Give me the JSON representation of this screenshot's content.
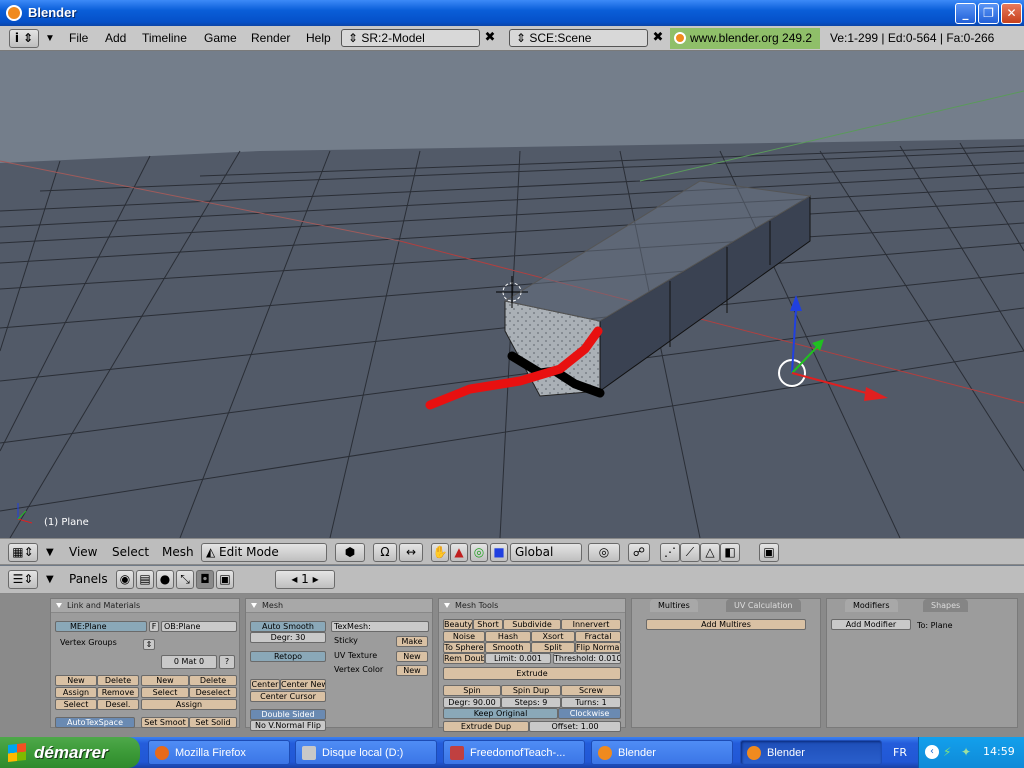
{
  "window": {
    "title": "Blender"
  },
  "menubar": {
    "menus": [
      "File",
      "Add",
      "Timeline",
      "Game",
      "Render",
      "Help"
    ],
    "screen": "SR:2-Model",
    "scene": "SCE:Scene",
    "close_glyph": "✖",
    "website": "www.blender.org 249.2",
    "stats": "Ve:1-299 | Ed:0-564 | Fa:0-266"
  },
  "viewport": {
    "object_info": "(1) Plane"
  },
  "view_header": {
    "view": "View",
    "select": "Select",
    "mesh": "Mesh",
    "mode": "Edit Mode",
    "orientation": "Global"
  },
  "buttons_header": {
    "panels": "Panels",
    "frame": "1"
  },
  "panels": {
    "link_materials": {
      "title": "Link and Materials",
      "me": "ME:Plane",
      "f": "F",
      "ob": "OB:Plane",
      "vertex_groups": "Vertex Groups",
      "mat": "0 Mat 0",
      "q": "?",
      "new1": "New",
      "delete1": "Delete",
      "new2": "New",
      "delete2": "Delete",
      "assign1": "Assign",
      "remove": "Remove",
      "select1": "Select",
      "deselect1": "Deselect",
      "select2": "Select",
      "desel": "Desel.",
      "assign2": "Assign",
      "autotex": "AutoTexSpace",
      "setsmooth": "Set Smoot",
      "setsolid": "Set Solid"
    },
    "mesh": {
      "title": "Mesh",
      "auto_smooth": "Auto Smooth",
      "degr": "Degr: 30",
      "texmesh": "TexMesh:",
      "sticky": "Sticky",
      "make": "Make",
      "retopo": "Retopo",
      "uv_texture": "UV Texture",
      "new1": "New",
      "vertex_color": "Vertex Color",
      "new2": "New",
      "center": "Center",
      "center_new": "Center New",
      "center_cursor": "Center Cursor",
      "double_sided": "Double Sided",
      "no_vnormal": "No V.Normal Flip"
    },
    "mesh_tools": {
      "title": "Mesh Tools",
      "beauty": "Beauty",
      "short": "Short",
      "subdivide": "Subdivide",
      "innervert": "Innervert",
      "noise": "Noise",
      "hash": "Hash",
      "xsort": "Xsort",
      "fractal": "Fractal",
      "to_sphere": "To Sphere",
      "smooth": "Smooth",
      "split": "Split",
      "flip_normal": "Flip Normal",
      "rem_doubl": "Rem Doubl",
      "limit": "Limit: 0.001",
      "threshold": "Threshold: 0.010",
      "extrude": "Extrude",
      "spin": "Spin",
      "spin_dup": "Spin Dup",
      "screw": "Screw",
      "degr": "Degr: 90.00",
      "steps": "Steps: 9",
      "turns": "Turns: 1",
      "keep_original": "Keep Original",
      "clockwise": "Clockwise",
      "extrude_dup": "Extrude Dup",
      "offset": "Offset: 1.00"
    },
    "multires": {
      "tab1": "Multires",
      "tab2": "UV Calculation",
      "add": "Add Multires"
    },
    "modifiers": {
      "tab1": "Modifiers",
      "tab2": "Shapes",
      "add": "Add Modifier",
      "to": "To: Plane"
    }
  },
  "taskbar": {
    "start": "démarrer",
    "tasks": [
      "Mozilla Firefox",
      "Disque local (D:)",
      "FreedomofTeach-...",
      "Blender",
      "Blender"
    ],
    "lang": "FR",
    "time": "14:59"
  },
  "colors": {
    "accent": "#0a5ed8",
    "stats_bg": "#8fbf69",
    "button": "#d9c1a4",
    "drawing": "#e81010"
  }
}
